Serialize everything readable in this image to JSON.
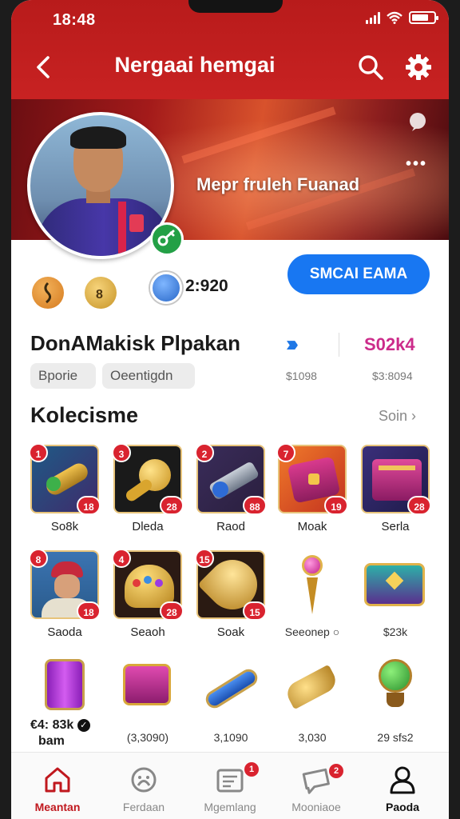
{
  "status_bar": {
    "time": "18:48"
  },
  "header": {
    "title": "Nergaai hemgai",
    "back_icon": "chevron-left-icon",
    "search_icon": "search-icon",
    "settings_icon": "gear-icon"
  },
  "banner": {
    "name": "Mepr fruleh Fuanad",
    "more": "•••",
    "colors": {
      "primary_red": "#c82222",
      "accent_blue": "#1877f2",
      "badge_red": "#d9232f",
      "pink": "#cc2b8a",
      "online_green": "#23a046"
    }
  },
  "stats": {
    "coin_count": "2:920",
    "action_button": "SMCAI EAMA"
  },
  "profile": {
    "name": "DonAMakisk Plpakan",
    "chips": [
      "Bporie",
      "Oeentigdn"
    ],
    "stat_value": "S02k4",
    "sub_left": "$1098",
    "sub_right": "$3:8094"
  },
  "collection": {
    "title": "Kolecisme",
    "see_all": "Soin",
    "row1": [
      {
        "label": "So8k",
        "num": "1",
        "count": "18"
      },
      {
        "label": "Dleda",
        "num": "3",
        "count": "28"
      },
      {
        "label": "Raod",
        "num": "2",
        "count": "88"
      },
      {
        "label": "Moak",
        "num": "7",
        "count": "19"
      },
      {
        "label": "Serla",
        "num": "",
        "count": "28"
      }
    ],
    "row2": [
      {
        "label": "Saoda",
        "num": "8",
        "count": "18"
      },
      {
        "label": "Seaoh",
        "num": "4",
        "count": "28"
      },
      {
        "label": "Soak",
        "num": "15",
        "count": "15"
      },
      {
        "label": "Seeonep",
        "num": "",
        "count": ""
      },
      {
        "label": "$23k",
        "num": "",
        "count": ""
      }
    ],
    "row3": [
      {
        "label": ""
      },
      {
        "label": "(3,3090)"
      },
      {
        "label": "3,1090"
      },
      {
        "label": "3,030"
      },
      {
        "label": "29 sfs2"
      }
    ],
    "row3_price_1": "€4: 83k",
    "row3_price_2": "bam",
    "row3_check": "✓"
  },
  "bottom_nav": {
    "items": [
      {
        "label": "Meantan",
        "icon": "home-icon",
        "badge": ""
      },
      {
        "label": "Ferdaan",
        "icon": "compass-icon",
        "badge": ""
      },
      {
        "label": "Mgemlang",
        "icon": "inbox-icon",
        "badge": "1"
      },
      {
        "label": "Mooniaoe",
        "icon": "chat-icon",
        "badge": "2"
      },
      {
        "label": "Paoda",
        "icon": "user-icon",
        "badge": ""
      }
    ]
  }
}
